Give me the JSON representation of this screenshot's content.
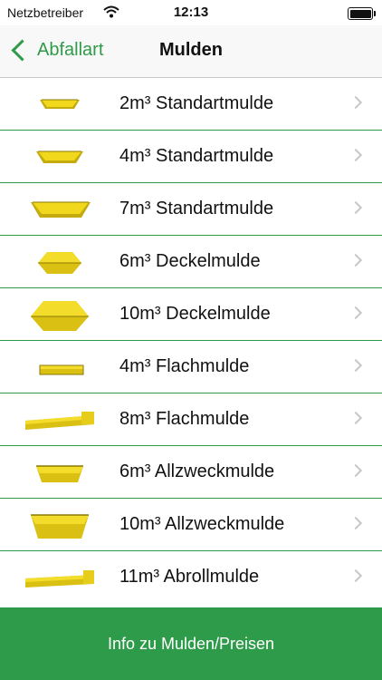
{
  "status_bar": {
    "carrier": "Netzbetreiber",
    "time": "12:13"
  },
  "nav": {
    "back_label": "Abfallart",
    "title": "Mulden"
  },
  "items": [
    {
      "label": "2m³ Standartmulde",
      "icon": "skip-standard-icon"
    },
    {
      "label": "4m³ Standartmulde",
      "icon": "skip-standard-icon"
    },
    {
      "label": "7m³ Standartmulde",
      "icon": "skip-standard-icon"
    },
    {
      "label": "6m³ Deckelmulde",
      "icon": "skip-lidded-icon"
    },
    {
      "label": "10m³ Deckelmulde",
      "icon": "skip-lidded-icon"
    },
    {
      "label": "4m³ Flachmulde",
      "icon": "skip-flat-icon"
    },
    {
      "label": "8m³ Flachmulde",
      "icon": "skip-flat-icon"
    },
    {
      "label": "6m³ Allzweckmulde",
      "icon": "skip-allpurpose-icon"
    },
    {
      "label": "10m³ Allzweckmulde",
      "icon": "skip-allpurpose-icon"
    },
    {
      "label": "11m³ Abrollmulde",
      "icon": "skip-rolloff-icon"
    }
  ],
  "footer_button": "Info zu Mulden/Preisen",
  "colors": {
    "accent": "#2e9b4a",
    "skip_yellow": "#f2d81c",
    "skip_dark": "#b59f0b"
  }
}
